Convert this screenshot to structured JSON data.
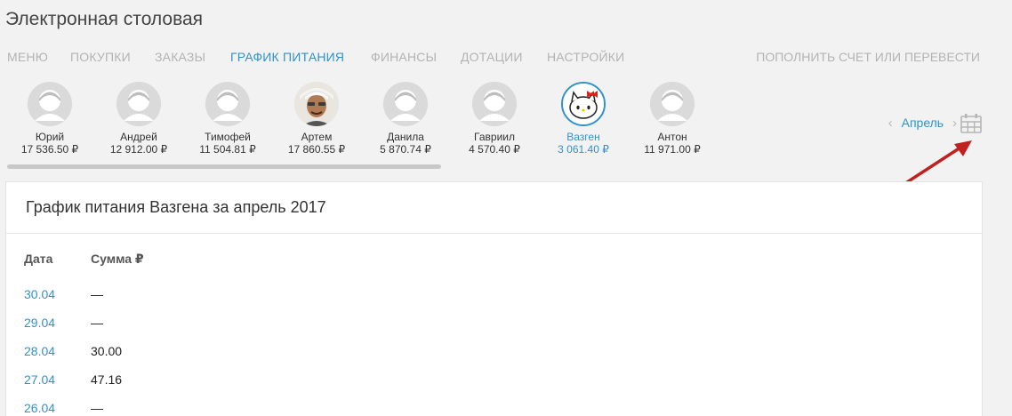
{
  "app": {
    "title": "Электронная столовая"
  },
  "nav": {
    "items": [
      "Меню",
      "Покупки",
      "Заказы",
      "График питания",
      "Финансы",
      "Дотации",
      "Настройки"
    ],
    "active_index": 3,
    "topup": "ПОПОЛНИТЬ СЧЕТ ИЛИ ПЕРЕВЕСТИ"
  },
  "kids": [
    {
      "name": "Юрий",
      "balance": "17 536.50 ₽",
      "avatar": "placeholder"
    },
    {
      "name": "Андрей",
      "balance": "12 912.00 ₽",
      "avatar": "placeholder"
    },
    {
      "name": "Тимофей",
      "balance": "11 504.81 ₽",
      "avatar": "placeholder"
    },
    {
      "name": "Артем",
      "balance": "17 860.55 ₽",
      "avatar": "photo"
    },
    {
      "name": "Данила",
      "balance": "5 870.74 ₽",
      "avatar": "placeholder"
    },
    {
      "name": "Гавриил",
      "balance": "4 570.40 ₽",
      "avatar": "placeholder"
    },
    {
      "name": "Вазген",
      "balance": "3 061.40 ₽",
      "avatar": "hello-kitty",
      "active": true
    },
    {
      "name": "Антон",
      "balance": "11 971.00 ₽",
      "avatar": "placeholder"
    }
  ],
  "month_nav": {
    "label": "Апрель",
    "prev_icon": "chevron-left-icon",
    "next_icon": "chevron-right-icon",
    "calendar_icon": "calendar-grid-icon"
  },
  "card": {
    "title": "График питания Вазгена за апрель 2017",
    "columns": {
      "date": "Дата",
      "sum": "Сумма ₽"
    },
    "rows": [
      {
        "date": "30.04",
        "sum": "—"
      },
      {
        "date": "29.04",
        "sum": "—"
      },
      {
        "date": "28.04",
        "sum": "30.00"
      },
      {
        "date": "27.04",
        "sum": "47.16"
      },
      {
        "date": "26.04",
        "sum": "—"
      }
    ]
  },
  "colors": {
    "accent": "#3192c9",
    "muted": "#b3b3b3",
    "arrow": "#c0201f"
  }
}
